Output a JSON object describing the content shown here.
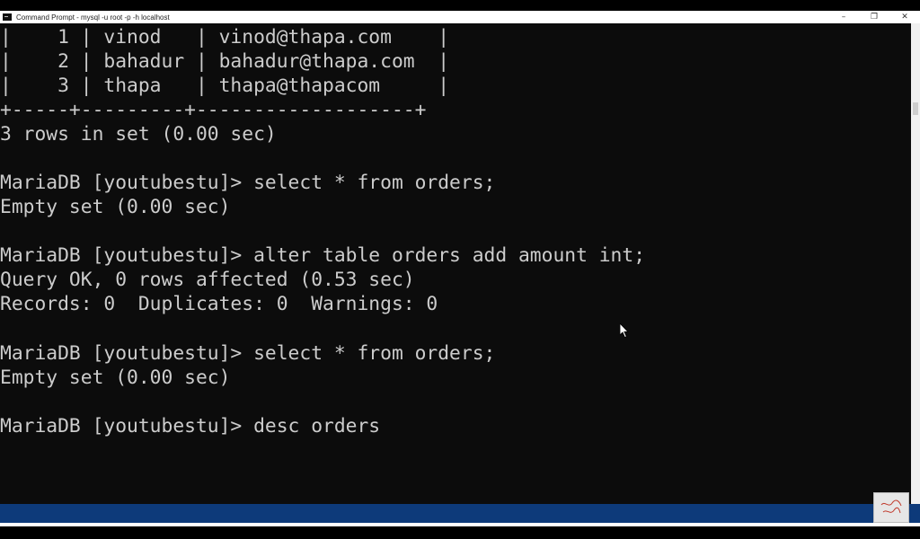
{
  "window": {
    "title": "Command Prompt - mysql -u root -p -h localhost",
    "minimize_glyph": "–",
    "restore_glyph": "❐",
    "close_glyph": "✕"
  },
  "console": {
    "lines": [
      "|    1 | vinod   | vinod@thapa.com    |",
      "|    2 | bahadur | bahadur@thapa.com  |",
      "|    3 | thapa   | thapa@thapacom     |",
      "+-----+---------+-------------------+",
      "3 rows in set (0.00 sec)",
      "",
      "MariaDB [youtubestu]> select * from orders;",
      "Empty set (0.00 sec)",
      "",
      "MariaDB [youtubestu]> alter table orders add amount int;",
      "Query OK, 0 rows affected (0.53 sec)",
      "Records: 0  Duplicates: 0  Warnings: 0",
      "",
      "MariaDB [youtubestu]> select * from orders;",
      "Empty set (0.00 sec)",
      "",
      "MariaDB [youtubestu]> desc orders"
    ]
  },
  "icons": {
    "app": "cmd-icon",
    "cursor": "mouse-pointer-icon",
    "watermark": "channel-logo-icon"
  },
  "colors": {
    "console_bg": "#0c0c0c",
    "console_text": "#cccccc",
    "titlebar_bg": "#ffffff",
    "taskbar_bg": "#0d3a7a"
  }
}
